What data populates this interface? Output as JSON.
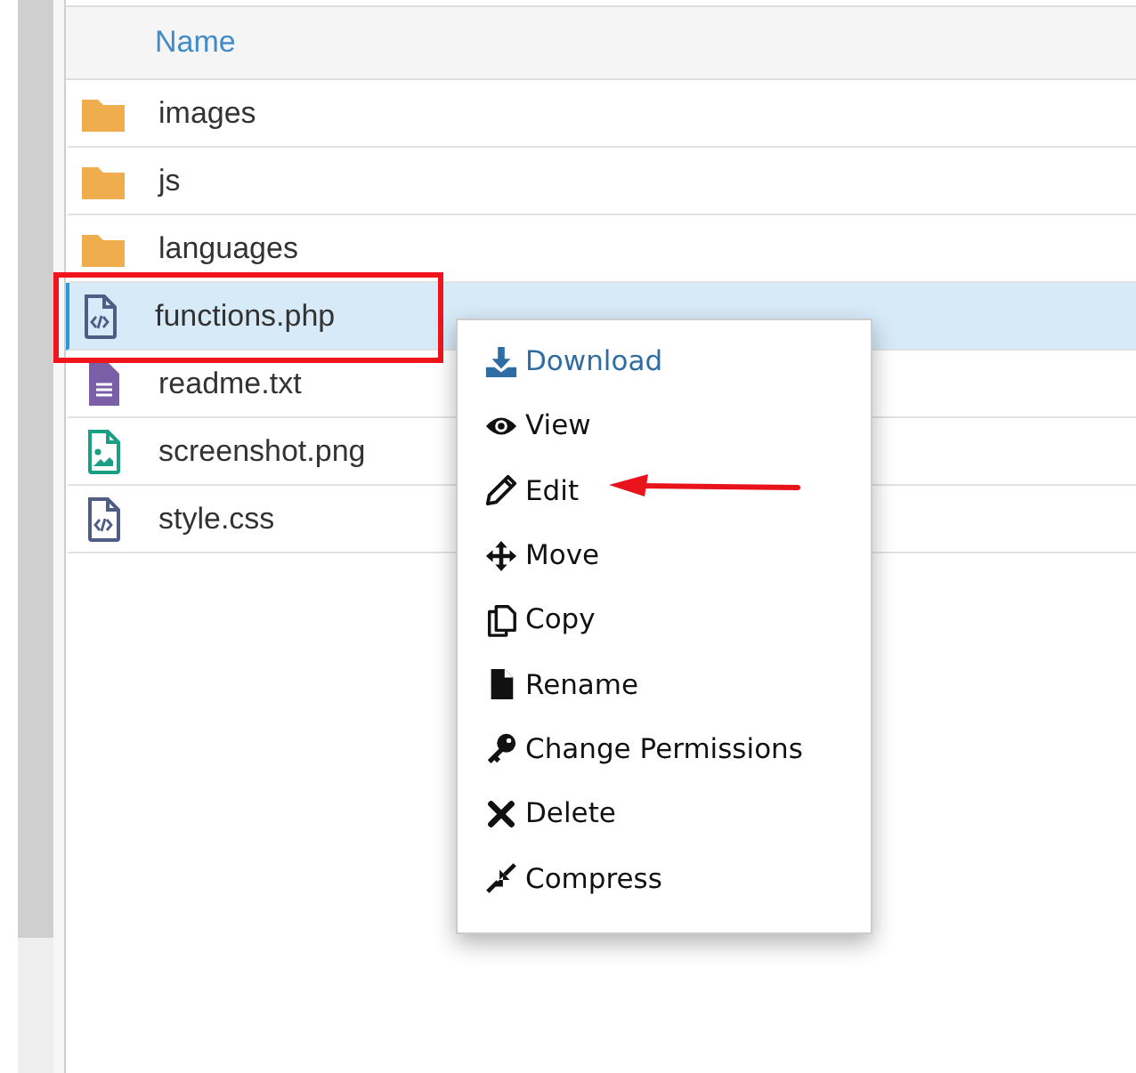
{
  "table": {
    "columns": [
      "Name"
    ],
    "rows": [
      {
        "kind": "folder",
        "name": "images",
        "selected": false
      },
      {
        "kind": "folder",
        "name": "js",
        "selected": false
      },
      {
        "kind": "folder",
        "name": "languages",
        "selected": false
      },
      {
        "kind": "code",
        "name": "functions.php",
        "selected": true
      },
      {
        "kind": "text",
        "name": "readme.txt",
        "selected": false
      },
      {
        "kind": "image",
        "name": "screenshot.png",
        "selected": false
      },
      {
        "kind": "code",
        "name": "style.css",
        "selected": false
      }
    ]
  },
  "context_menu": {
    "items": [
      {
        "kind": "download",
        "label": "Download",
        "highlighted": true
      },
      {
        "kind": "view",
        "label": "View",
        "highlighted": false
      },
      {
        "kind": "edit",
        "label": "Edit",
        "highlighted": false
      },
      {
        "kind": "move",
        "label": "Move",
        "highlighted": false
      },
      {
        "kind": "copy",
        "label": "Copy",
        "highlighted": false
      },
      {
        "kind": "rename",
        "label": "Rename",
        "highlighted": false
      },
      {
        "kind": "permissions",
        "label": "Change Permissions",
        "highlighted": false
      },
      {
        "kind": "delete",
        "label": "Delete",
        "highlighted": false
      },
      {
        "kind": "compress",
        "label": "Compress",
        "highlighted": false
      }
    ]
  }
}
